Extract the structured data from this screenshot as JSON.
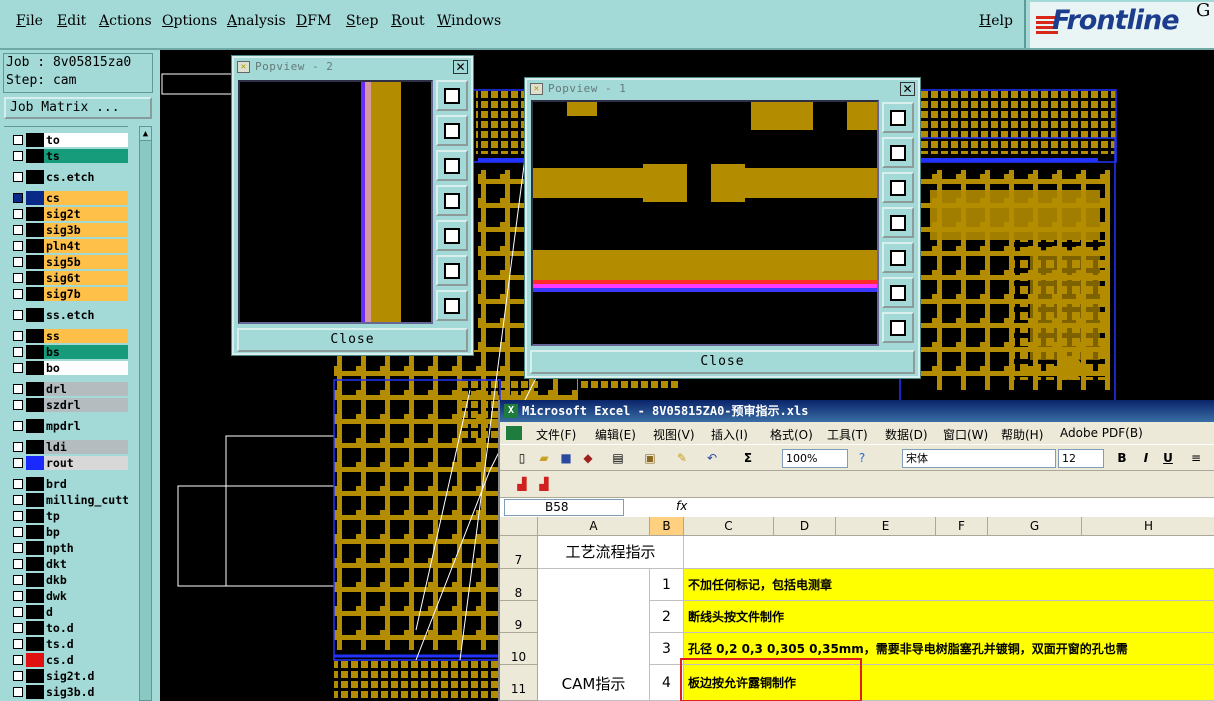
{
  "menu": {
    "items": [
      "File",
      "Edit",
      "Actions",
      "Options",
      "Analysis",
      "DFM",
      "Step",
      "Rout",
      "Windows"
    ],
    "help": "Help"
  },
  "logo": {
    "text": "Frontline",
    "suffix": "G"
  },
  "job": {
    "job_line": "Job : 8v05815za0",
    "step_line": "Step: cam",
    "matrix_button": "Job Matrix ..."
  },
  "layers": [
    {
      "name": "to",
      "color": "#ffffff",
      "swatch": "#000000",
      "gap": false
    },
    {
      "name": "ts",
      "color": "#169c7a",
      "swatch": "#000000",
      "gap": false
    },
    {
      "name": "cs.etch",
      "color": "#a3d9d6",
      "swatch": "#000000",
      "gap": true
    },
    {
      "name": "cs",
      "color": "#ffc04a",
      "swatch": "#0a2a8a",
      "gap": true,
      "checked": true
    },
    {
      "name": "sig2t",
      "color": "#ffc04a",
      "swatch": "#000000",
      "gap": false
    },
    {
      "name": "sig3b",
      "color": "#ffc04a",
      "swatch": "#000000",
      "gap": false
    },
    {
      "name": "pln4t",
      "color": "#ffc04a",
      "swatch": "#000000",
      "gap": false
    },
    {
      "name": "sig5b",
      "color": "#ffc04a",
      "swatch": "#000000",
      "gap": false
    },
    {
      "name": "sig6t",
      "color": "#ffc04a",
      "swatch": "#000000",
      "gap": false
    },
    {
      "name": "sig7b",
      "color": "#ffc04a",
      "swatch": "#000000",
      "gap": false
    },
    {
      "name": "ss.etch",
      "color": "#a3d9d6",
      "swatch": "#000000",
      "gap": true
    },
    {
      "name": "ss",
      "color": "#ffc04a",
      "swatch": "#000000",
      "gap": true
    },
    {
      "name": "bs",
      "color": "#169c7a",
      "swatch": "#000000",
      "gap": false
    },
    {
      "name": "bo",
      "color": "#ffffff",
      "swatch": "#000000",
      "gap": false
    },
    {
      "name": "drl",
      "color": "#b4bcc0",
      "swatch": "#000000",
      "gap": true
    },
    {
      "name": "szdrl",
      "color": "#b4bcc0",
      "swatch": "#000000",
      "gap": false
    },
    {
      "name": "mpdrl",
      "color": "#a3d9d6",
      "swatch": "#000000",
      "gap": true
    },
    {
      "name": "ldi",
      "color": "#b4bcc0",
      "swatch": "#000000",
      "gap": true
    },
    {
      "name": "rout",
      "color": "#d8d8d8",
      "swatch": "#1a2aff",
      "gap": false
    },
    {
      "name": "brd",
      "color": "#a3d9d6",
      "swatch": "#000000",
      "gap": true
    },
    {
      "name": "milling_cutt",
      "color": "#a3d9d6",
      "swatch": "#000000",
      "gap": false
    },
    {
      "name": "tp",
      "color": "#a3d9d6",
      "swatch": "#000000",
      "gap": false
    },
    {
      "name": "bp",
      "color": "#a3d9d6",
      "swatch": "#000000",
      "gap": false
    },
    {
      "name": "npth",
      "color": "#a3d9d6",
      "swatch": "#000000",
      "gap": false
    },
    {
      "name": "dkt",
      "color": "#a3d9d6",
      "swatch": "#000000",
      "gap": false
    },
    {
      "name": "dkb",
      "color": "#a3d9d6",
      "swatch": "#000000",
      "gap": false
    },
    {
      "name": "dwk",
      "color": "#a3d9d6",
      "swatch": "#000000",
      "gap": false
    },
    {
      "name": "d",
      "color": "#a3d9d6",
      "swatch": "#000000",
      "gap": false
    },
    {
      "name": "to.d",
      "color": "#a3d9d6",
      "swatch": "#000000",
      "gap": false
    },
    {
      "name": "ts.d",
      "color": "#a3d9d6",
      "swatch": "#000000",
      "gap": false
    },
    {
      "name": "cs.d",
      "color": "#a3d9d6",
      "swatch": "#e01010",
      "gap": false
    },
    {
      "name": "sig2t.d",
      "color": "#a3d9d6",
      "swatch": "#000000",
      "gap": false
    },
    {
      "name": "sig3b.d",
      "color": "#a3d9d6",
      "swatch": "#000000",
      "gap": false
    }
  ],
  "popview2": {
    "title": "Popview - 2",
    "close": "Close"
  },
  "popview1": {
    "title": "Popview - 1",
    "close": "Close"
  },
  "excel": {
    "title": "Microsoft Excel - 8V05815ZA0-预审指示.xls",
    "menu": [
      "文件(F)",
      "编辑(E)",
      "视图(V)",
      "插入(I)",
      "格式(O)",
      "工具(T)",
      "数据(D)",
      "窗口(W)",
      "帮助(H)",
      "Adobe PDF(B)"
    ],
    "zoom": "100%",
    "font": "宋体",
    "font_size": "12",
    "name_box": "B58",
    "fx": "fx",
    "columns": [
      "A",
      "B",
      "C",
      "D",
      "E",
      "F",
      "G",
      "H"
    ],
    "rows": [
      {
        "num": "7",
        "a": "工艺流程指示",
        "b": "",
        "c": ""
      },
      {
        "num": "8",
        "a": "",
        "b": "1",
        "c": "不加任何标记，包括电测章"
      },
      {
        "num": "9",
        "a": "",
        "b": "2",
        "c": "断线头按文件制作"
      },
      {
        "num": "10",
        "a": "",
        "b": "3",
        "c": "孔径 0,2  0,3  0,305  0,35mm，需要非导电树脂塞孔并镀铜，双面开窗的孔也需"
      },
      {
        "num": "11",
        "a": "CAM指示",
        "b": "4",
        "c": "板边按允许露铜制作"
      }
    ]
  },
  "colors": {
    "copper": "#b48c00",
    "teal": "#a3d9d6",
    "highlight": "#ffff00"
  }
}
